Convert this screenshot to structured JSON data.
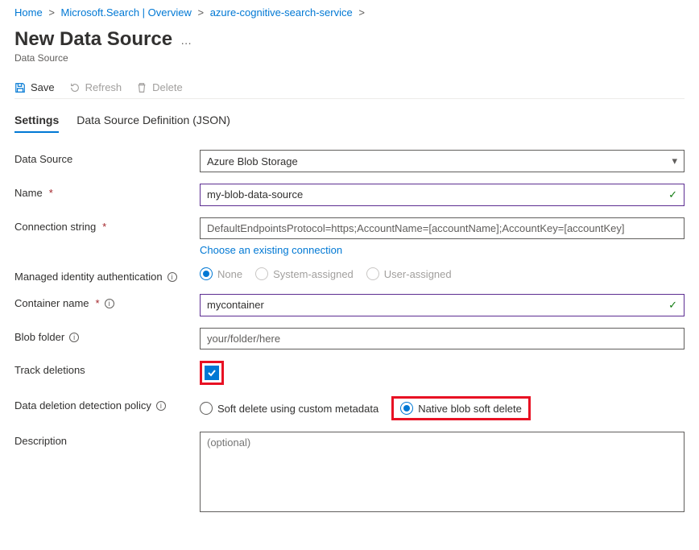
{
  "breadcrumb": {
    "home": "Home",
    "search": "Microsoft.Search | Overview",
    "service": "azure-cognitive-search-service"
  },
  "page": {
    "title": "New Data Source",
    "subtitle": "Data Source"
  },
  "toolbar": {
    "save": "Save",
    "refresh": "Refresh",
    "delete": "Delete"
  },
  "tabs": {
    "settings": "Settings",
    "json": "Data Source Definition (JSON)"
  },
  "form": {
    "dataSource": {
      "label": "Data Source",
      "value": "Azure Blob Storage"
    },
    "name": {
      "label": "Name",
      "value": "my-blob-data-source"
    },
    "connectionString": {
      "label": "Connection string",
      "value": "DefaultEndpointsProtocol=https;AccountName=[accountName];AccountKey=[accountKey]",
      "chooseExisting": "Choose an existing connection"
    },
    "managedIdentity": {
      "label": "Managed identity authentication",
      "options": {
        "none": "None",
        "system": "System-assigned",
        "user": "User-assigned"
      },
      "selected": "none"
    },
    "containerName": {
      "label": "Container name",
      "value": "mycontainer"
    },
    "blobFolder": {
      "label": "Blob folder",
      "value": "your/folder/here"
    },
    "trackDeletions": {
      "label": "Track deletions",
      "checked": true
    },
    "policy": {
      "label": "Data deletion detection policy",
      "options": {
        "softCustom": "Soft delete using custom metadata",
        "nativeSoft": "Native blob soft delete"
      },
      "selected": "nativeSoft"
    },
    "description": {
      "label": "Description",
      "placeholder": "(optional)"
    }
  }
}
